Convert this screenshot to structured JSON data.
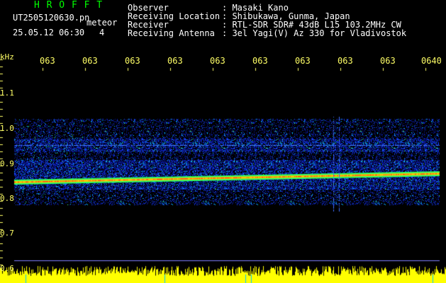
{
  "header": {
    "station": "H R O F F T",
    "filename": "UT2505120630.pn",
    "tag": "meteor",
    "datetime": "25.05.12 06:30",
    "count": "4",
    "info_labels": [
      "Observer",
      "Receiving Location",
      "Receiver",
      "Receiving Antenna"
    ],
    "info_values": [
      ": Masaki Kano",
      ": Shibukawa, Gunma, Japan",
      ": RTL-SDR SDR# 43dB L15 103.2MHz CW",
      ": 3el Yagi(V) Az 330 for Vladivostok"
    ]
  },
  "axis": {
    "unit": "kHz",
    "y_ticks": [
      "1.1",
      "1.0",
      "0.9",
      "0.8",
      "0.7",
      "0.6"
    ],
    "x_ticks": [
      "063",
      "063",
      "063",
      "063",
      "063",
      "063",
      "063",
      "063",
      "063",
      "0640"
    ]
  },
  "colors": {
    "bg": "#000000",
    "header_green": "#00ff00",
    "label_yellow": "#ffff66",
    "noise_blue": "#1a3cff",
    "signal_red": "#ff2020",
    "amplitude_yellow": "#ffff00"
  }
}
